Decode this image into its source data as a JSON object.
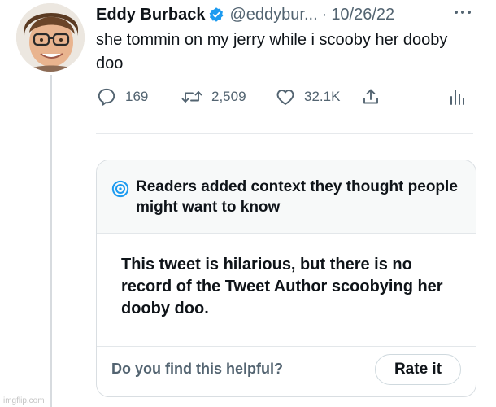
{
  "tweet": {
    "author_name": "Eddy Burback",
    "handle": "@eddybur...",
    "separator": "·",
    "date": "10/26/22",
    "text": "she tommin on my jerry while i scooby her dooby doo",
    "icons": {
      "verified": "verified-badge-icon",
      "more": "more-dots-icon"
    }
  },
  "actions": {
    "reply_count": "169",
    "retweet_count": "2,509",
    "like_count": "32.1K",
    "icons": [
      "reply-icon",
      "retweet-icon",
      "like-icon",
      "share-icon",
      "analytics-icon"
    ]
  },
  "community_note": {
    "title": "Readers added context they thought people might want to know",
    "body": "This tweet is hilarious, but there is no record of the Tweet Author scoobying her dooby doo.",
    "question": "Do you find this helpful?",
    "rate_button": "Rate it"
  },
  "watermark": "imgflip.com",
  "colors": {
    "verified_blue": "#1d9bf0",
    "secondary_text": "#536471",
    "note_icon_blue": "#1d9bf0",
    "card_header_bg": "#f7f9f9"
  }
}
